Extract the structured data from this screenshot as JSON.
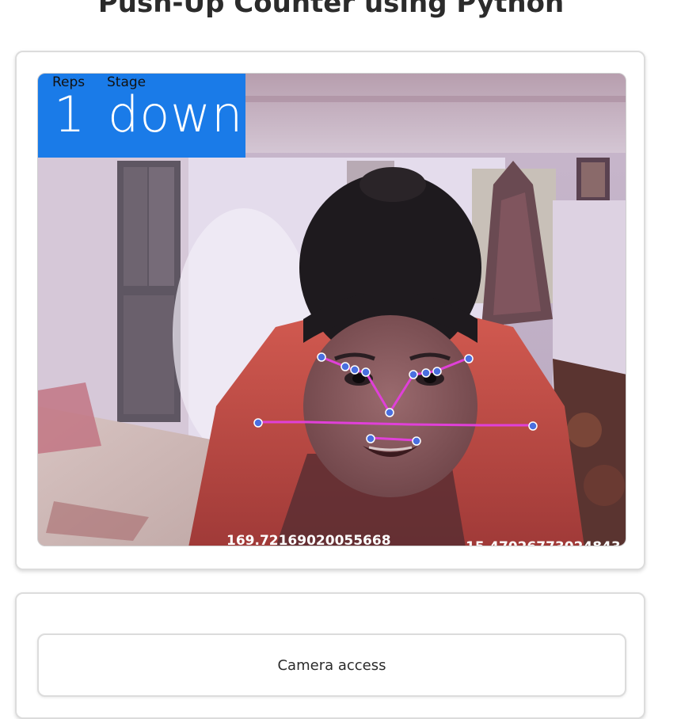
{
  "page": {
    "title": "Push-Up Counter using Python"
  },
  "video": {
    "hud": {
      "reps_label": "Reps",
      "stage_label": "Stage",
      "reps_value": "1",
      "stage_value": "down",
      "background_color": "#1a7be8"
    },
    "angles": {
      "left": "169.72169020055668",
      "right": "15.47026773024843"
    },
    "landmark_color": "#4a6fe0",
    "connection_color": "#e040d8"
  },
  "controls": {
    "camera_button_label": "Camera access"
  }
}
